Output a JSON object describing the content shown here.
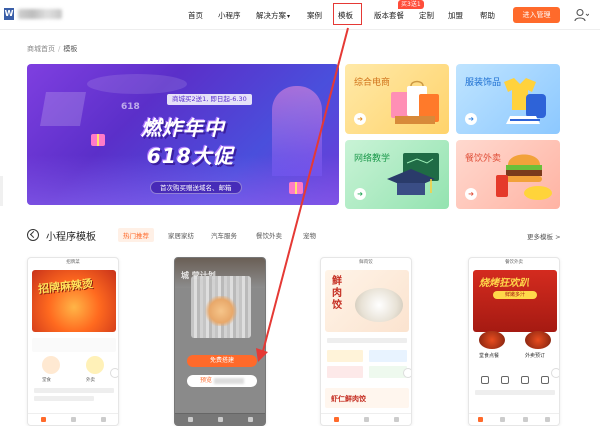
{
  "header": {
    "logo_mark": "W",
    "nav": [
      {
        "label": "首页"
      },
      {
        "label": "小程序"
      },
      {
        "label": "解决方案"
      },
      {
        "label": "案例"
      },
      {
        "label": "模板"
      },
      {
        "label": "版本套餐"
      },
      {
        "label": "定制"
      },
      {
        "label": "加盟"
      },
      {
        "label": "帮助"
      }
    ],
    "badge": "买3送1",
    "join_button": "进入管理"
  },
  "breadcrumb": {
    "home": "商城首页",
    "separator": "/",
    "current": "模板"
  },
  "banner": {
    "subtitle": "商城买2送1, 即日起-6.30",
    "title_line1": "燃炸年中",
    "title_line2": "618大促",
    "tag": "618",
    "footer": "首次购买赠送域名、邮箱"
  },
  "categories": [
    {
      "label": "综合电商"
    },
    {
      "label": "服装饰品"
    },
    {
      "label": "网络教学"
    },
    {
      "label": "餐饮外卖"
    }
  ],
  "section": {
    "title": "小程序模板",
    "tabs": [
      "热门推荐",
      "家居家纺",
      "汽车服务",
      "餐饮外卖",
      "宠物"
    ],
    "more": "更多模板 >"
  },
  "templates": [
    {
      "top": "招牌菜",
      "hero_text": "招牌麻辣烫",
      "order_label": "外卖",
      "dine_label": "堂食"
    },
    {
      "top_text": "城 营计划",
      "cta": "免费搭建",
      "cta2": "预览"
    },
    {
      "top": "鲜肉饺",
      "hero_text": "鲜肉饺",
      "band_text": "虾仁鲜肉饺"
    },
    {
      "top": "餐饮外卖",
      "hero_text": "烧烤狂欢趴",
      "pill": "鲜嫩多汁",
      "dine_label": "堂食点餐",
      "takeout_label": "外卖预订"
    }
  ],
  "colors": {
    "accent": "#ff6a2b",
    "annotation": "#e53935"
  }
}
